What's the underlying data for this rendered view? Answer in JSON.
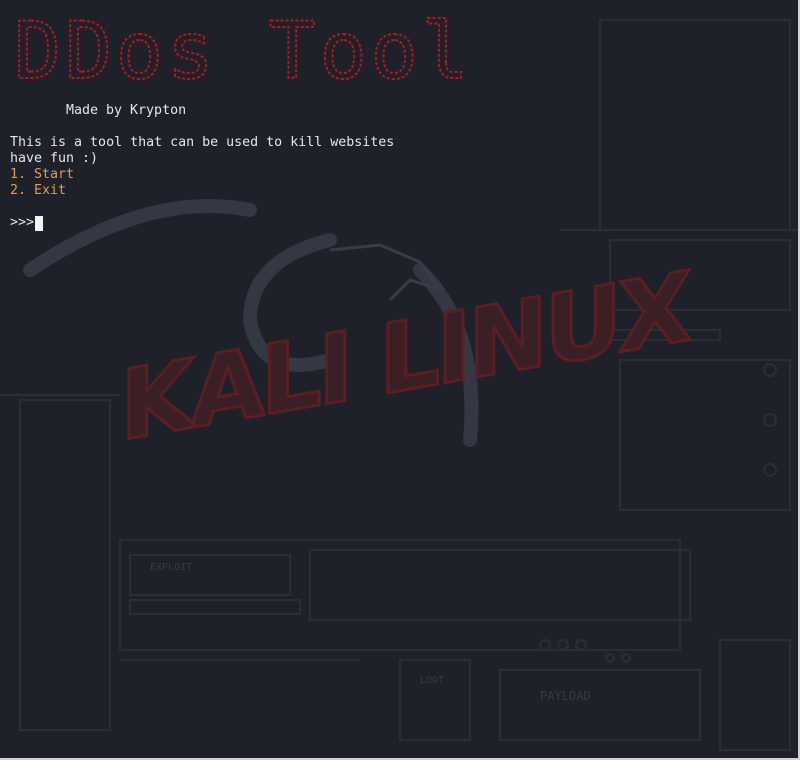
{
  "terminal": {
    "banner_text": "DDos Tool",
    "credit": "Made by Krypton",
    "description_lines": [
      "This is a tool that can be used to kill websites",
      "have fun :)"
    ],
    "menu": [
      {
        "label": "1. Start"
      },
      {
        "label": "2. Exit"
      }
    ],
    "prompt": ">>>",
    "wallpaper": {
      "logo_text": "KALI LINUX",
      "labels": [
        "EXPLOIT",
        "PAYLOAD",
        "LOOT"
      ]
    }
  },
  "colors": {
    "background": "#1f212a",
    "text": "#e6e6e6",
    "menu_text": "#e59a4f",
    "banner": "#b3171f",
    "cursor": "#f2f2f2"
  }
}
